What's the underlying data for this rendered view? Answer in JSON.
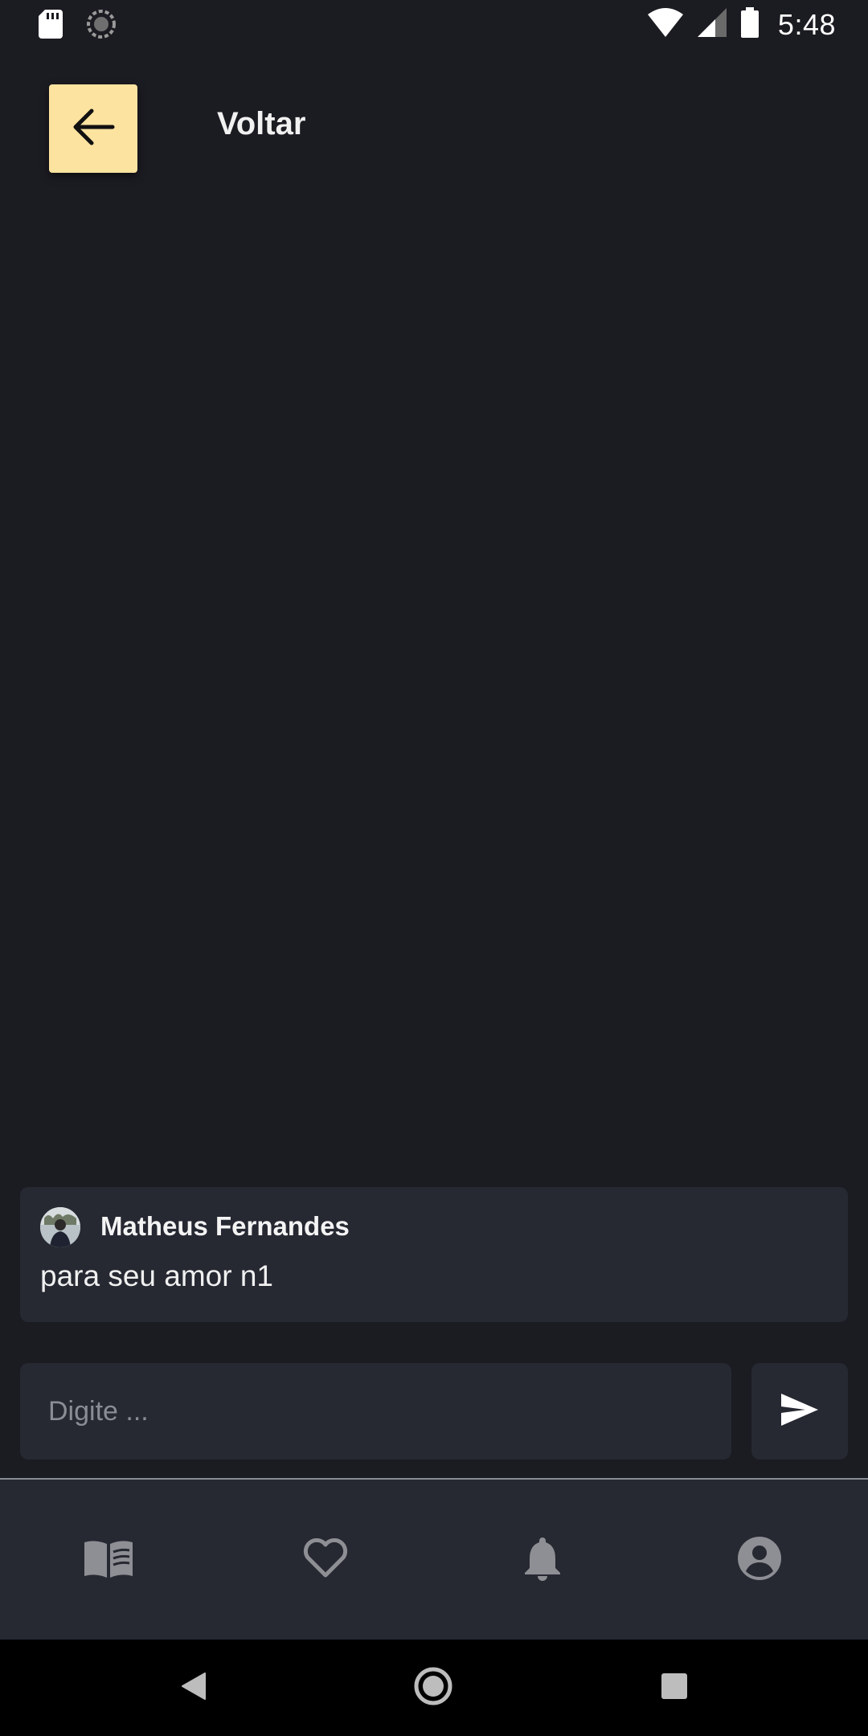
{
  "status_bar": {
    "time": "5:48",
    "icons": [
      "sd-card-icon",
      "sync-icon",
      "wifi-icon",
      "cellular-signal-icon",
      "battery-icon"
    ]
  },
  "header": {
    "back_icon": "arrow-left-icon",
    "title": "Voltar",
    "accent_color": "#fde3a0"
  },
  "comment": {
    "author": "Matheus Fernandes",
    "text": "para seu amor n1"
  },
  "input": {
    "placeholder": "Digite ...",
    "value": "",
    "send_icon": "send-icon"
  },
  "bottom_nav": {
    "items": [
      {
        "icon": "book-icon"
      },
      {
        "icon": "heart-outline-icon"
      },
      {
        "icon": "bell-icon"
      },
      {
        "icon": "account-circle-icon"
      }
    ]
  },
  "system_nav": {
    "items": [
      "back-triangle-icon",
      "home-circle-icon",
      "recents-square-icon"
    ]
  },
  "colors": {
    "background": "#1b1b22",
    "surface": "#262832",
    "text": "#f0f0f0",
    "icon_muted": "#8e8f94"
  }
}
